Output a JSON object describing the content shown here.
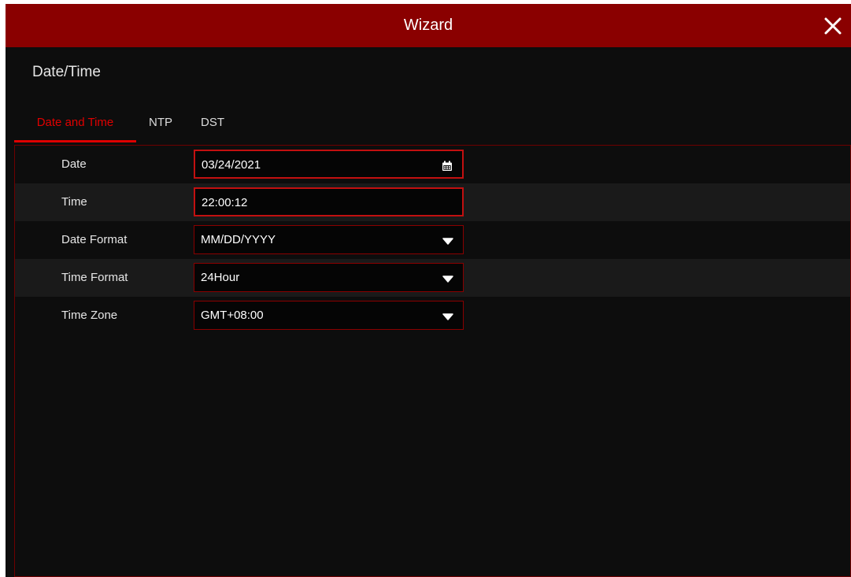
{
  "window": {
    "title": "Wizard"
  },
  "section_title": "Date/Time",
  "tabs": [
    {
      "label": "Date and Time",
      "active": true
    },
    {
      "label": "NTP",
      "active": false
    },
    {
      "label": "DST",
      "active": false
    }
  ],
  "fields": [
    {
      "label": "Date",
      "value": "03/24/2021",
      "icon": "calendar-icon"
    },
    {
      "label": "Time",
      "value": "22:00:12"
    },
    {
      "label": "Date Format",
      "value": "MM/DD/YYYY",
      "icon": "dropdown-arrow-icon"
    },
    {
      "label": "Time Format",
      "value": "24Hour",
      "icon": "dropdown-arrow-icon"
    },
    {
      "label": "Time Zone",
      "value": "GMT+08:00",
      "icon": "dropdown-arrow-icon"
    }
  ],
  "colors": {
    "title_bar": "#8a0000",
    "accent": "#e00000",
    "background": "#0d0d0d",
    "alt_row": "#1a1a1a"
  }
}
